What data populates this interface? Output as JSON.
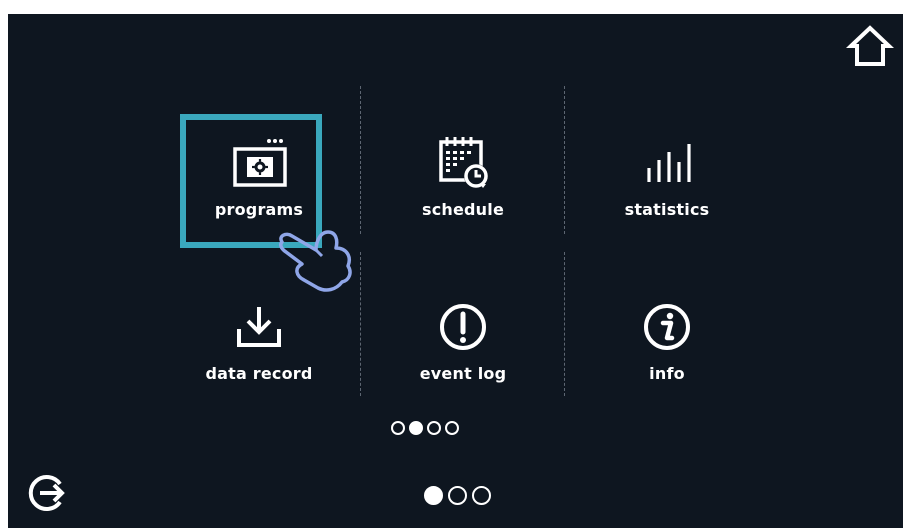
{
  "menu": {
    "tiles": [
      {
        "label": "programs",
        "icon": "program-settings-icon"
      },
      {
        "label": "schedule",
        "icon": "calendar-clock-icon"
      },
      {
        "label": "statistics",
        "icon": "bar-chart-icon"
      },
      {
        "label": "data record",
        "icon": "download-icon"
      },
      {
        "label": "event log",
        "icon": "exclamation-circle-icon"
      },
      {
        "label": "info",
        "icon": "info-circle-icon"
      }
    ],
    "selected": "programs"
  },
  "page_indicator_upper": {
    "count": 4,
    "active_index": 1
  },
  "page_indicator_lower": {
    "count": 3,
    "active_index": 0
  },
  "colors": {
    "background": "#0e1620",
    "highlight": "#3aa8bd",
    "hand": "#8fa6e8",
    "text": "#ffffff"
  },
  "icons": {
    "home": "home-icon",
    "exit": "exit-icon",
    "gesture": "pointing-hand-icon"
  }
}
